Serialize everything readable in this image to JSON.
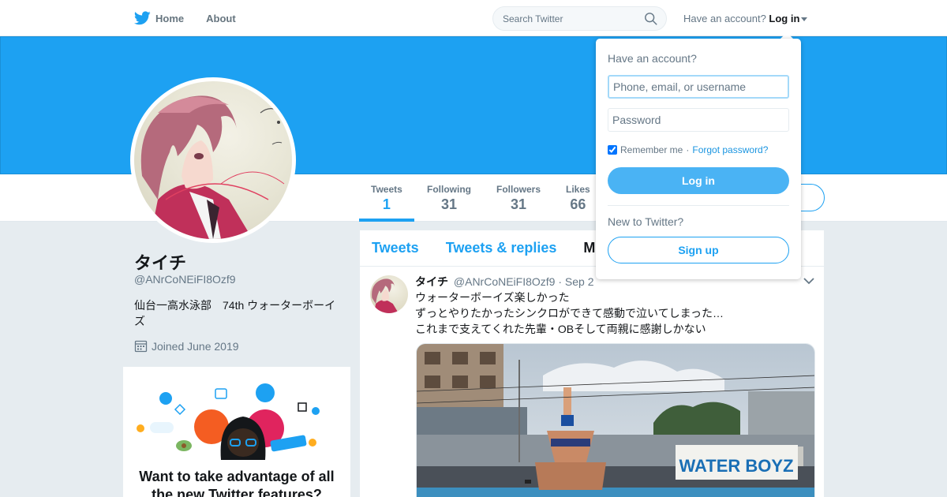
{
  "nav": {
    "home_label": "Home",
    "about_label": "About",
    "search_placeholder": "Search Twitter",
    "have_account": "Have an account?",
    "login_label": "Log in"
  },
  "colors": {
    "brand": "#1da1f2",
    "text": "#14171a",
    "muted": "#657786"
  },
  "profile": {
    "name": "タイチ",
    "handle": "@ANrCoNEiFI8Ozf9",
    "bio": "仙台一高水泳部　74th ウォーターボーイズ",
    "joined": "Joined June 2019"
  },
  "stats": [
    {
      "label": "Tweets",
      "value": "1"
    },
    {
      "label": "Following",
      "value": "31"
    },
    {
      "label": "Followers",
      "value": "31"
    },
    {
      "label": "Likes",
      "value": "66"
    }
  ],
  "tabs": [
    "Tweets",
    "Tweets & replies",
    "M"
  ],
  "tweet": {
    "name": "タイチ",
    "handle": "@ANrCoNEiFI8Ozf9",
    "date": "· Sep 2",
    "lines": [
      "ウォーターボーイズ楽しかった",
      "ずっとやりたかったシンクロができて感動で泣いてしまった…",
      "これまで支えてくれた先輩・OBそして両親に感謝しかない"
    ],
    "media_sign": "WATER BOYZ"
  },
  "promo": {
    "title": "Want to take advantage of all the new Twitter features?"
  },
  "login_dropdown": {
    "title": "Have an account?",
    "username_placeholder": "Phone, email, or username",
    "password_placeholder": "Password",
    "remember": "Remember me",
    "separator": "·",
    "forgot": "Forgot password?",
    "login_button": "Log in",
    "new_title": "New to Twitter?",
    "signup_button": "Sign up"
  }
}
